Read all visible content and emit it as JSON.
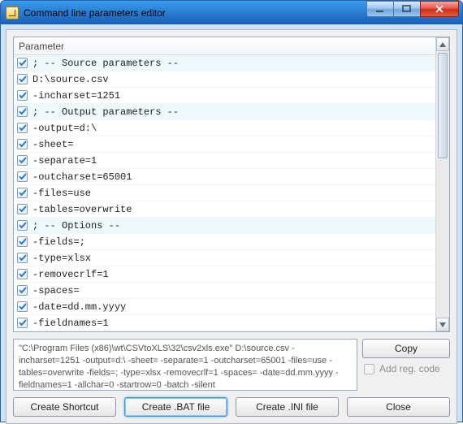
{
  "window": {
    "title": "Command line parameters editor"
  },
  "list": {
    "header": "Parameter",
    "rows": [
      {
        "text": "; -- Source parameters --",
        "alt": true
      },
      {
        "text": "D:\\source.csv",
        "alt": false
      },
      {
        "text": "-incharset=1251",
        "alt": false
      },
      {
        "text": "; -- Output parameters --",
        "alt": true
      },
      {
        "text": "-output=d:\\",
        "alt": false
      },
      {
        "text": "-sheet=",
        "alt": false
      },
      {
        "text": "-separate=1",
        "alt": false
      },
      {
        "text": "-outcharset=65001",
        "alt": false
      },
      {
        "text": "-files=use",
        "alt": false
      },
      {
        "text": "-tables=overwrite",
        "alt": false
      },
      {
        "text": "; -- Options --",
        "alt": true
      },
      {
        "text": "-fields=;",
        "alt": false
      },
      {
        "text": "-type=xlsx",
        "alt": false
      },
      {
        "text": "-removecrlf=1",
        "alt": false
      },
      {
        "text": "-spaces=",
        "alt": false
      },
      {
        "text": "-date=dd.mm.yyyy",
        "alt": false
      },
      {
        "text": "-fieldnames=1",
        "alt": false
      }
    ]
  },
  "command_text": "\"C:\\Program Files (x86)\\wt\\CSVtoXLS\\32\\csv2xls.exe\" D:\\source.csv -incharset=1251 -output=d:\\ -sheet= -separate=1 -outcharset=65001 -files=use -tables=overwrite -fields=; -type=xlsx -removecrlf=1 -spaces= -date=dd.mm.yyyy -fieldnames=1 -allchar=0 -startrow=0 -batch -silent",
  "buttons": {
    "copy": "Copy",
    "add_reg": "Add reg. code",
    "create_shortcut": "Create Shortcut",
    "create_bat": "Create .BAT file",
    "create_ini": "Create .INI file",
    "close": "Close"
  }
}
